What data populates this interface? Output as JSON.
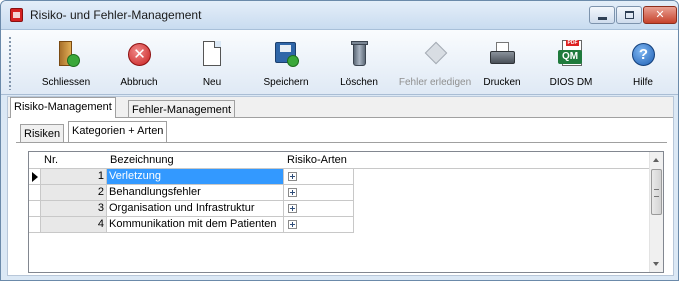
{
  "window": {
    "title": "Risiko- und Fehler-Management",
    "minimize_glyph": "",
    "close_glyph": "✕"
  },
  "toolbar": {
    "buttons": [
      {
        "label": "Schliessen",
        "icon": "exit-door-icon",
        "enabled": true
      },
      {
        "label": "Abbruch",
        "icon": "cancel-icon",
        "enabled": true
      },
      {
        "label": "Neu",
        "icon": "new-document-icon",
        "enabled": true
      },
      {
        "label": "Speichern",
        "icon": "save-disk-icon",
        "enabled": true
      },
      {
        "label": "Löschen",
        "icon": "trash-bin-icon",
        "enabled": true
      },
      {
        "label": "Fehler erledigen",
        "icon": "resolve-error-icon",
        "enabled": false
      },
      {
        "label": "Drucken",
        "icon": "printer-icon",
        "enabled": true
      },
      {
        "label": "DIOS DM",
        "icon": "dios-dm-icon",
        "enabled": true
      },
      {
        "label": "Hilfe",
        "icon": "help-icon",
        "enabled": true
      }
    ],
    "cancel_glyph": "✕",
    "help_glyph": "?",
    "pdf_badge": "PDF",
    "qm_text": "QM"
  },
  "outer_tabs": [
    {
      "label": "Risiko-Management",
      "active": true
    },
    {
      "label": "Fehler-Management",
      "active": false
    }
  ],
  "inner_tabs": [
    {
      "label": "Risiken",
      "active": false
    },
    {
      "label": "Kategorien + Arten",
      "active": true
    }
  ],
  "grid": {
    "columns": [
      "Nr.",
      "Bezeichnung",
      "Risiko-Arten"
    ],
    "rows": [
      {
        "nr": "1",
        "bezeichnung": "Verletzung",
        "selected": true
      },
      {
        "nr": "2",
        "bezeichnung": "Behandlungsfehler",
        "selected": false
      },
      {
        "nr": "3",
        "bezeichnung": "Organisation und Infrastruktur",
        "selected": false
      },
      {
        "nr": "4",
        "bezeichnung": "Kommunikation mit dem Patienten",
        "selected": false
      }
    ]
  },
  "colors": {
    "selection": "#3399ff",
    "window_frame": "#dbe8f5"
  }
}
